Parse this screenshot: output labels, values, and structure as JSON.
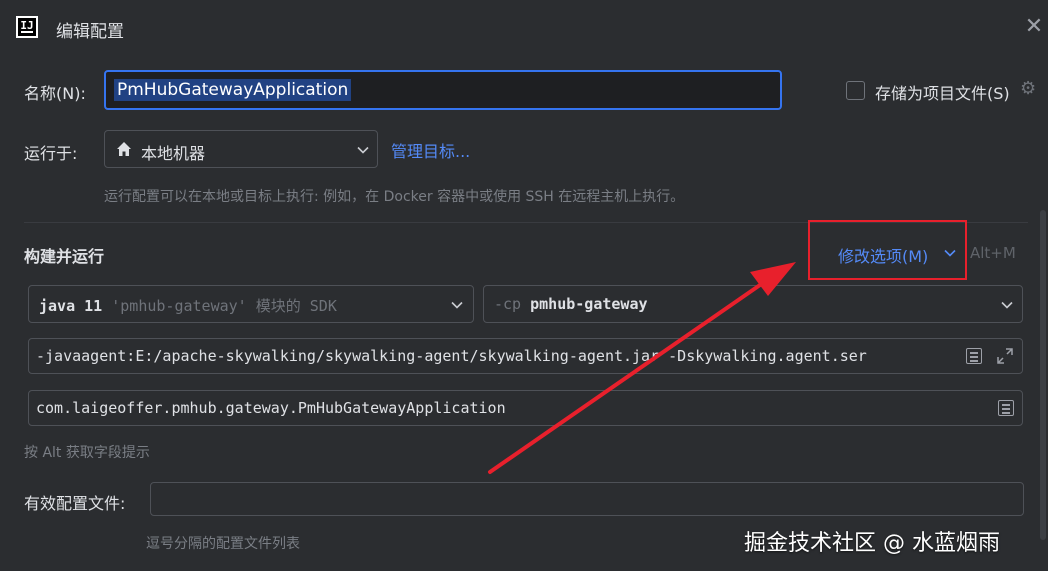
{
  "window": {
    "title": "编辑配置",
    "close_glyph": "✕"
  },
  "name_field": {
    "label": "名称(N):",
    "value": "PmHubGatewayApplication"
  },
  "store_as_project_file": {
    "label": "存储为项目文件(S)",
    "checked": false
  },
  "run_on": {
    "label": "运行于:",
    "selected": "本地机器",
    "manage_link": "管理目标...",
    "hint": "运行配置可以在本地或目标上执行: 例如，在 Docker 容器中或使用 SSH 在远程主机上执行。"
  },
  "build_and_run": {
    "title": "构建并运行",
    "modify_options": "修改选项(M)",
    "shortcut": "Alt+M",
    "jdk": {
      "bold": "java 11",
      "gray": "'pmhub-gateway' 模块的 SDK"
    },
    "classpath": {
      "prefix": "-cp",
      "module": "pmhub-gateway"
    },
    "vm_options": "-javaagent:E:/apache-skywalking/skywalking-agent/skywalking-agent.jar -Dskywalking.agent.ser",
    "main_class": "com.laigeoffer.pmhub.gateway.PmHubGatewayApplication",
    "field_hint": "按 Alt 获取字段提示"
  },
  "active_profiles": {
    "label": "有效配置文件:",
    "value": "",
    "hint": "逗号分隔的配置文件列表"
  },
  "watermark": "掘金技术社区 @ 水蓝烟雨",
  "colors": {
    "background": "#2b2d30",
    "accent": "#3574f0",
    "link": "#548af7",
    "annotation_red": "#e8202c"
  }
}
